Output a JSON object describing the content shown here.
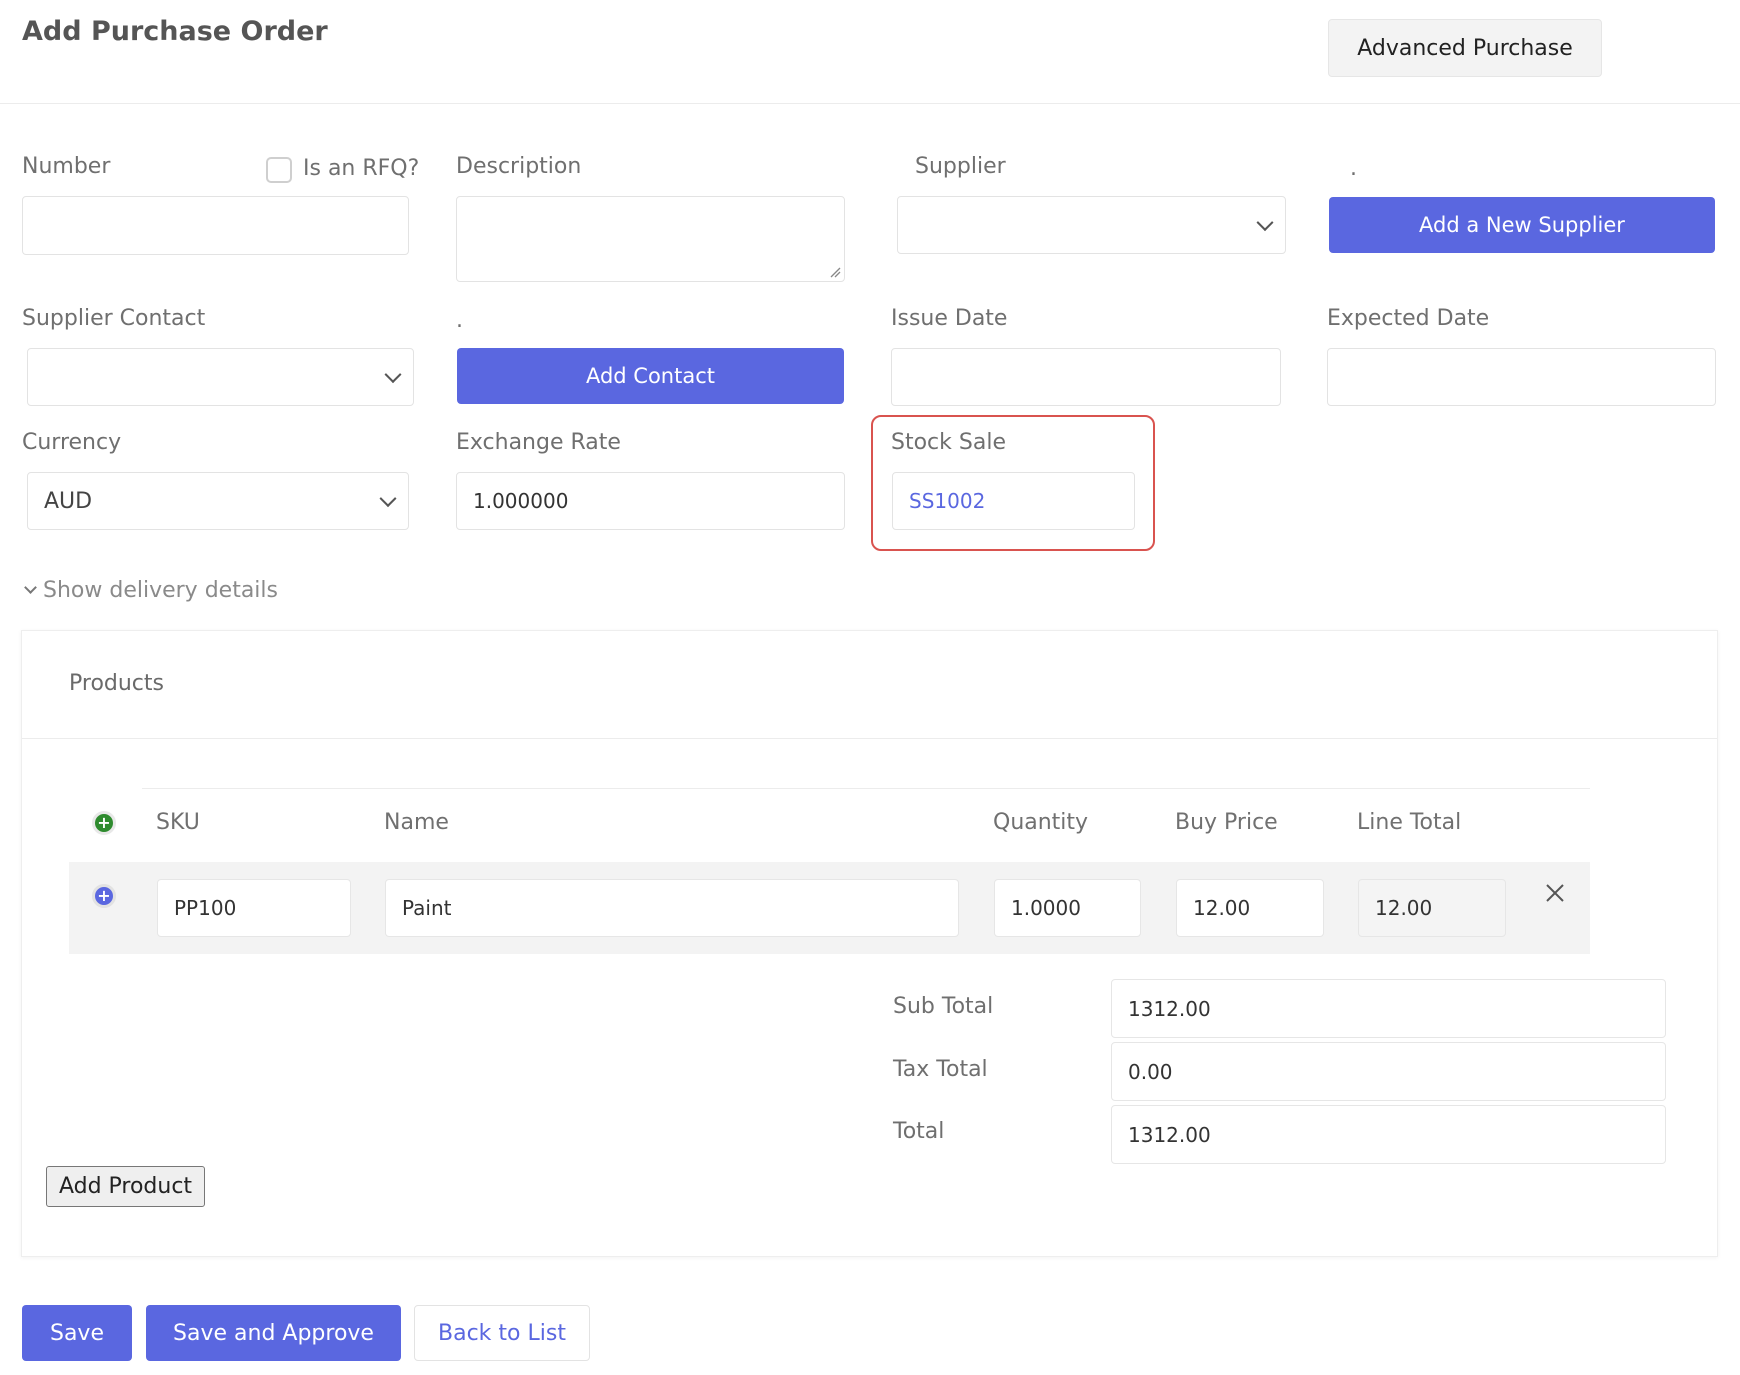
{
  "header": {
    "title": "Add Purchase Order",
    "advanced_button": "Advanced Purchase"
  },
  "form": {
    "number_label": "Number",
    "rfq_label": "Is an RFQ?",
    "description_label": "Description",
    "supplier_label": "Supplier",
    "supplier_spacer_label": ".",
    "add_supplier_button": "Add a New Supplier",
    "supplier_contact_label": "Supplier Contact",
    "contact_spacer_label": ".",
    "add_contact_button": "Add Contact",
    "issue_date_label": "Issue Date",
    "expected_date_label": "Expected Date",
    "currency_label": "Currency",
    "currency_value": "AUD",
    "exchange_rate_label": "Exchange Rate",
    "exchange_rate_value": "1.000000",
    "stock_sale_label": "Stock Sale",
    "stock_sale_value": "SS1002",
    "highlight_color": "#d9534f",
    "accent_color": "#5a67e0"
  },
  "delivery_toggle": "Show delivery details",
  "products": {
    "panel_title": "Products",
    "columns": [
      "SKU",
      "Name",
      "Quantity",
      "Buy Price",
      "Line Total"
    ],
    "rows": [
      {
        "sku": "PP100",
        "name": "Paint",
        "quantity": "1.0000",
        "buy_price": "12.00",
        "line_total": "12.00"
      }
    ],
    "totals": {
      "sub_total_label": "Sub Total",
      "sub_total": "1312.00",
      "tax_total_label": "Tax Total",
      "tax_total": "0.00",
      "total_label": "Total",
      "total": "1312.00"
    },
    "add_product_button": "Add Product"
  },
  "footer": {
    "save": "Save",
    "save_approve": "Save and Approve",
    "back": "Back to List"
  }
}
